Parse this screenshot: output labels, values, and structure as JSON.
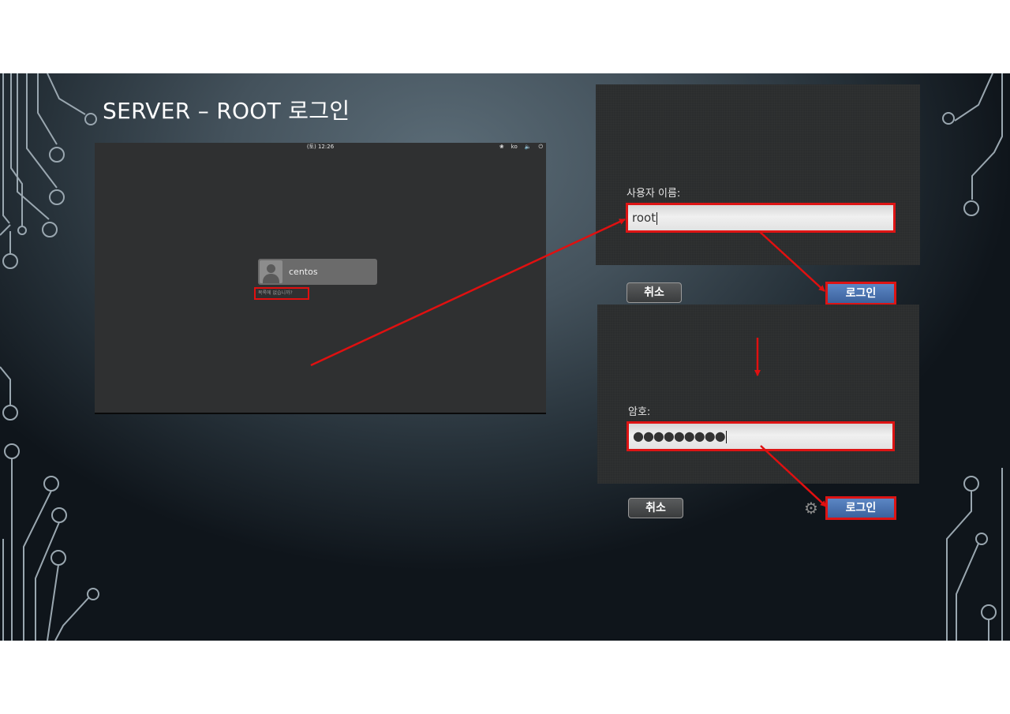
{
  "slide": {
    "title": "SERVER – ROOT 로그인"
  },
  "login_screen": {
    "clock": "(토) 12:26",
    "tray": {
      "accessibility_icon": "accessibility-icon",
      "language": "ko",
      "volume_icon": "volume-icon",
      "power_icon": "power-icon"
    },
    "user": {
      "avatar_icon": "user-avatar-icon",
      "name": "centos"
    },
    "not_listed_link": "목록에 없습니까?"
  },
  "username_dialog": {
    "label": "사용자 이름:",
    "value": "root",
    "cancel_label": "취소",
    "login_label": "로그인"
  },
  "password_dialog": {
    "label": "암호:",
    "value": "●●●●●●●●●",
    "cancel_label": "취소",
    "settings_icon": "gear-icon",
    "login_label": "로그인"
  },
  "colors": {
    "highlight": "#dd1414",
    "login_button": "#4a72b0",
    "slide_bg": "#44525c",
    "circuit": "#9aa7b0"
  }
}
